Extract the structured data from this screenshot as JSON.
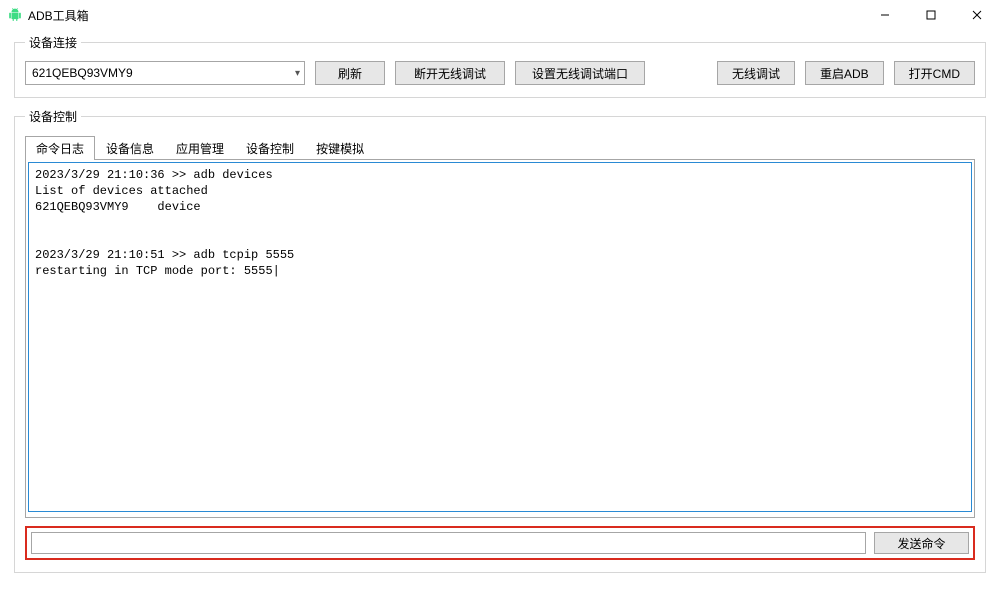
{
  "window": {
    "title": "ADB工具箱"
  },
  "device_connect": {
    "legend": "设备连接",
    "selected_device": "621QEBQ93VMY9",
    "refresh_label": "刷新",
    "disconnect_wifi_label": "断开无线调试",
    "set_wifi_port_label": "设置无线调试端口",
    "wifi_debug_label": "无线调试",
    "restart_adb_label": "重启ADB",
    "open_cmd_label": "打开CMD"
  },
  "device_control": {
    "legend": "设备控制",
    "tabs": {
      "log": "命令日志",
      "info": "设备信息",
      "apps": "应用管理",
      "control": "设备控制",
      "keys": "按键模拟"
    },
    "log_text": "2023/3/29 21:10:36 >> adb devices\nList of devices attached\n621QEBQ93VMY9    device\n\n\n2023/3/29 21:10:51 >> adb tcpip 5555\nrestarting in TCP mode port: 5555|",
    "command_value": "",
    "send_label": "发送命令"
  }
}
